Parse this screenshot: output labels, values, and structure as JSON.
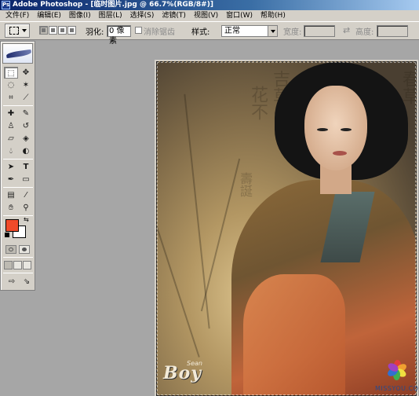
{
  "title_bar": {
    "text": "Adobe Photoshop - [临时图片.jpg @ 66.7%(RGB/8#)]"
  },
  "menu": [
    "文件(F)",
    "编辑(E)",
    "图像(I)",
    "图层(L)",
    "选择(S)",
    "滤镜(T)",
    "视图(V)",
    "窗口(W)",
    "帮助(H)"
  ],
  "options": {
    "feather_label": "羽化:",
    "feather_value": "0 像素",
    "antialias_label": "消除锯齿",
    "style_label": "样式:",
    "style_value": "正常",
    "width_label": "宽度:",
    "height_label": "高度:"
  },
  "colors": {
    "foreground": "#f04a2a",
    "background": "#ffffff"
  },
  "toolbox": {
    "tools": [
      "rect-marquee-icon",
      "move-icon",
      "lasso-icon",
      "magic-wand-icon",
      "crop-icon",
      "slice-icon",
      "healing-brush-icon",
      "brush-icon",
      "clone-stamp-icon",
      "history-brush-icon",
      "eraser-icon",
      "paint-bucket-icon",
      "blur-icon",
      "dodge-icon",
      "path-select-icon",
      "type-icon",
      "pen-icon",
      "shape-icon",
      "notes-icon",
      "eyedropper-icon",
      "hand-icon",
      "zoom-icon"
    ]
  },
  "document": {
    "brand_text": "Boy",
    "brand_small": "Sean"
  },
  "watermark": {
    "text": "MISSYOU.COM"
  }
}
